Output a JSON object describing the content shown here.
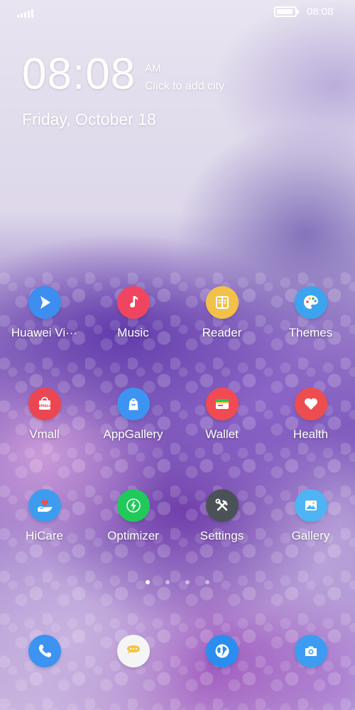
{
  "status_bar": {
    "time": "08:08",
    "battery_percent": 90
  },
  "clock_widget": {
    "time": "08:08",
    "ampm": "AM",
    "city_prompt": "Click to add city",
    "date": "Friday, October 18"
  },
  "apps": [
    {
      "label": "Huawei Vi···",
      "icon": "video-play-icon",
      "color": "#3d8ef0"
    },
    {
      "label": "Music",
      "icon": "music-note-icon",
      "color": "#f04561"
    },
    {
      "label": "Reader",
      "icon": "book-icon",
      "color": "#f3c04a"
    },
    {
      "label": "Themes",
      "icon": "palette-icon",
      "color": "#3ca4ee"
    },
    {
      "label": "Vmall",
      "icon": "shopping-bag-icon",
      "color": "#ea4753"
    },
    {
      "label": "AppGallery",
      "icon": "app-store-icon",
      "color": "#3d93f2"
    },
    {
      "label": "Wallet",
      "icon": "wallet-card-icon",
      "color": "#f24a52"
    },
    {
      "label": "Health",
      "icon": "heart-icon",
      "color": "#ee4d50"
    },
    {
      "label": "HiCare",
      "icon": "hand-heart-icon",
      "color": "#3d9cf0"
    },
    {
      "label": "Optimizer",
      "icon": "lightning-icon",
      "color": "#21c85a"
    },
    {
      "label": "Settings",
      "icon": "tools-icon",
      "color": "#4a5257"
    },
    {
      "label": "Gallery",
      "icon": "picture-icon",
      "color": "#4fb4f4"
    }
  ],
  "page_indicator": {
    "pages": 4,
    "current": 1
  },
  "dock": [
    {
      "icon": "phone-icon",
      "color": "#3d93f2"
    },
    {
      "icon": "messages-icon",
      "color": "#f5f5f5"
    },
    {
      "icon": "browser-globe-icon",
      "color": "#2c8df0"
    },
    {
      "icon": "camera-icon",
      "color": "#3c9cf2"
    }
  ]
}
